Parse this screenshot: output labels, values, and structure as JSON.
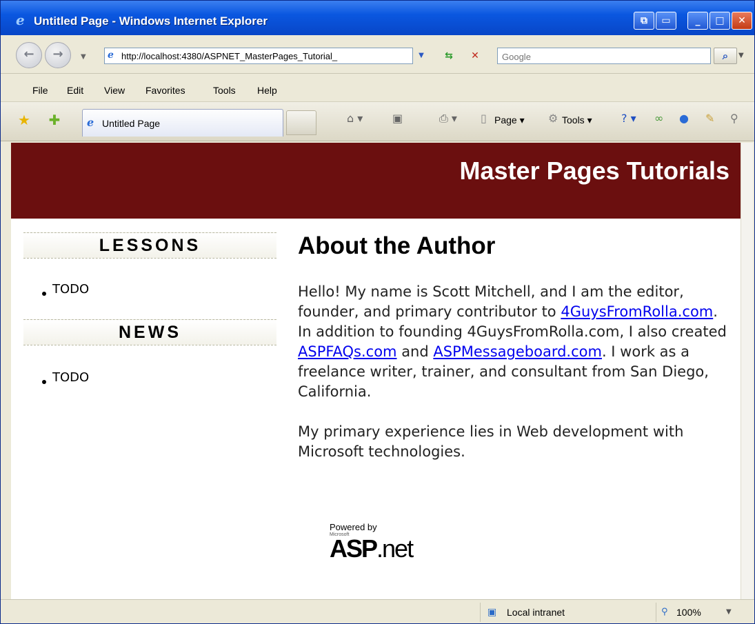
{
  "window": {
    "title": "Untitled Page - Windows Internet Explorer",
    "controls": [
      "⧉",
      "▭",
      "_",
      "□",
      "✕"
    ]
  },
  "address_bar": {
    "url": "http://localhost:4380/ASPNET_MasterPages_Tutorial_",
    "search_placeholder": "Google",
    "search_go": "⌕"
  },
  "menu": [
    "File",
    "Edit",
    "View",
    "Favorites",
    "Tools",
    "Help"
  ],
  "tab": {
    "label": "Untitled Page"
  },
  "command_bar": {
    "page": "Page",
    "tools": "Tools"
  },
  "page": {
    "banner_title": "Master Pages Tutorials",
    "sidebar": {
      "lessons_heading": "LESSONS",
      "lessons_items": [
        "TODO"
      ],
      "news_heading": "NEWS",
      "news_items": [
        "TODO"
      ]
    },
    "main": {
      "heading": "About the Author",
      "p1_a": "Hello! My name is Scott Mitchell, and I am the editor, founder, and primary contributor to ",
      "link1": "4GuysFromRolla.com",
      "p1_b": ". In addition to founding 4GuysFromRolla.com, I also created ",
      "link2": "ASPFAQs.com",
      "p1_c": " and ",
      "link3": "ASPMessageboard.com",
      "p1_d": ". I work as a freelance writer, trainer, and consultant from San Diego, California.",
      "p2": "My primary experience lies in Web development with Microsoft technologies."
    },
    "powered_by": {
      "line1": "Powered by",
      "line2": "Microsoft",
      "logo_a": "ASP",
      "logo_b": ".net"
    }
  },
  "status_bar": {
    "zone": "Local intranet",
    "zoom": "100%"
  },
  "colors": {
    "banner": "#6b0f0f",
    "titlebar": "#0a57e0",
    "link": "#0000ee"
  }
}
